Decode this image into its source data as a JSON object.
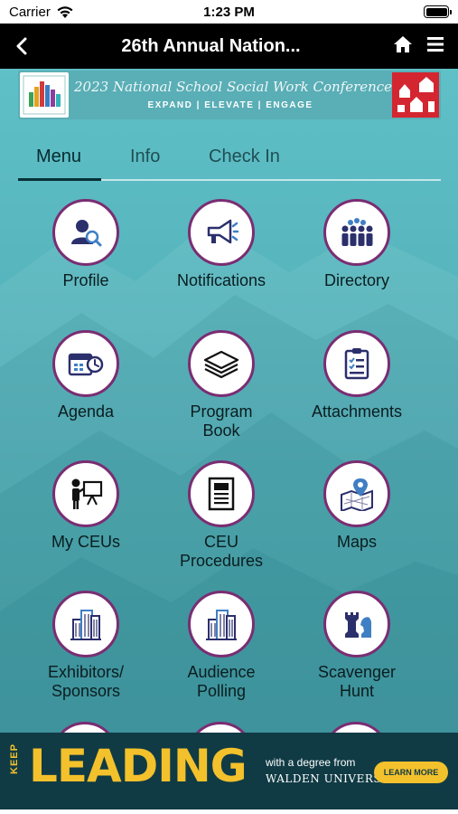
{
  "status_bar": {
    "carrier": "Carrier",
    "time": "1:23 PM"
  },
  "nav": {
    "title": "26th Annual Nation..."
  },
  "banner": {
    "title": "2023 National School Social Work Conference",
    "tagline": "EXPAND | ELEVATE | ENGAGE"
  },
  "tabs": [
    {
      "label": "Menu",
      "active": true
    },
    {
      "label": "Info",
      "active": false
    },
    {
      "label": "Check In",
      "active": false
    }
  ],
  "menu": [
    {
      "label": "Profile",
      "icon": "profile-icon"
    },
    {
      "label": "Notifications",
      "icon": "megaphone-icon"
    },
    {
      "label": "Directory",
      "icon": "people-icon"
    },
    {
      "label": "Agenda",
      "icon": "calendar-clock-icon"
    },
    {
      "label": "Program\nBook",
      "icon": "book-stack-icon"
    },
    {
      "label": "Attachments",
      "icon": "clipboard-icon"
    },
    {
      "label": "My CEUs",
      "icon": "presenter-icon"
    },
    {
      "label": "CEU\nProcedures",
      "icon": "document-icon"
    },
    {
      "label": "Maps",
      "icon": "map-pin-icon"
    },
    {
      "label": "Exhibitors/\nSponsors",
      "icon": "building-icon"
    },
    {
      "label": "Audience\nPolling",
      "icon": "building-icon"
    },
    {
      "label": "Scavenger\nHunt",
      "icon": "chess-icon"
    }
  ],
  "ad": {
    "keep": "KEEP",
    "headline": "LEADING",
    "line1": "with a degree from",
    "line2": "WALDEN UNIVERSITY",
    "cta": "LEARN MORE"
  },
  "colors": {
    "accent_ring": "#7a2d73",
    "icon_navy": "#2b2f6b",
    "ad_gold": "#f3c12c",
    "background_teal": "#56b4bc"
  }
}
